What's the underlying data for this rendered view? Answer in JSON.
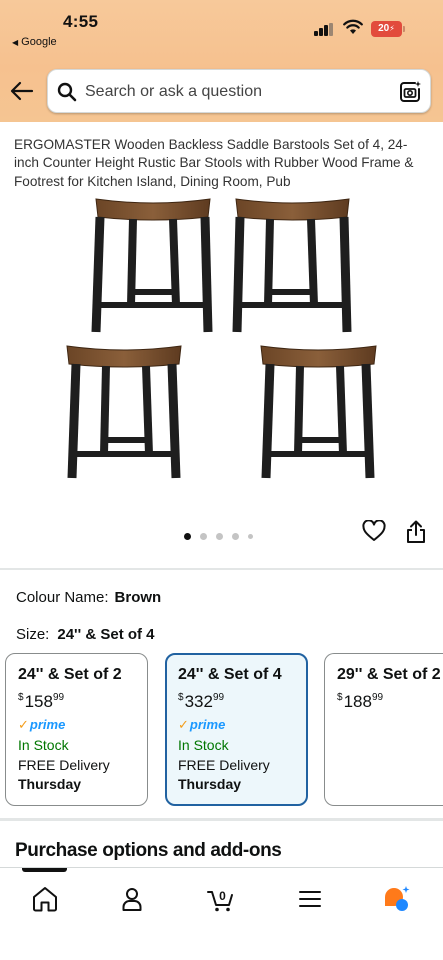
{
  "status_bar": {
    "time": "4:55",
    "back_app": "Google",
    "battery": "20"
  },
  "search": {
    "placeholder": "Search or ask a question"
  },
  "product": {
    "title": "ERGOMASTER Wooden Backless Saddle Barstools Set of 4, 24-inch Counter Height Rustic Bar Stools with Rubber Wood Frame & Footrest for Kitchen Island, Dining Room, Pub",
    "image_count": 5,
    "active_image": 1
  },
  "colour": {
    "label": "Colour Name:",
    "value": "Brown"
  },
  "size": {
    "label": "Size:",
    "value": "24'' & Set of 4"
  },
  "size_options": [
    {
      "title": "24'' & Set of 2",
      "currency": "$",
      "price_whole": "158",
      "price_fraction": "99",
      "prime": "prime",
      "stock": "In Stock",
      "delivery": "FREE Delivery",
      "day": "Thursday",
      "selected": false
    },
    {
      "title": "24'' & Set of 4",
      "currency": "$",
      "price_whole": "332",
      "price_fraction": "99",
      "prime": "prime",
      "stock": "In Stock",
      "delivery": "FREE Delivery",
      "day": "Thursday",
      "selected": true
    },
    {
      "title": "29'' & Set of 2",
      "currency": "$",
      "price_whole": "188",
      "price_fraction": "99",
      "selected": false
    }
  ],
  "purchase_options": {
    "title": "Purchase options and add-ons"
  },
  "bottom_nav": {
    "items": [
      {
        "icon": "home-icon",
        "active": true
      },
      {
        "icon": "account-icon",
        "active": false
      },
      {
        "icon": "cart-icon",
        "badge": "0",
        "active": false
      },
      {
        "icon": "menu-icon",
        "active": false
      },
      {
        "icon": "rufus-ai-icon",
        "active": false
      }
    ]
  },
  "colors": {
    "header": "#f6c18f",
    "selected_border": "#2162a1",
    "in_stock": "#007600",
    "prime": "#1a98ff",
    "battery": "#e24b3c"
  }
}
